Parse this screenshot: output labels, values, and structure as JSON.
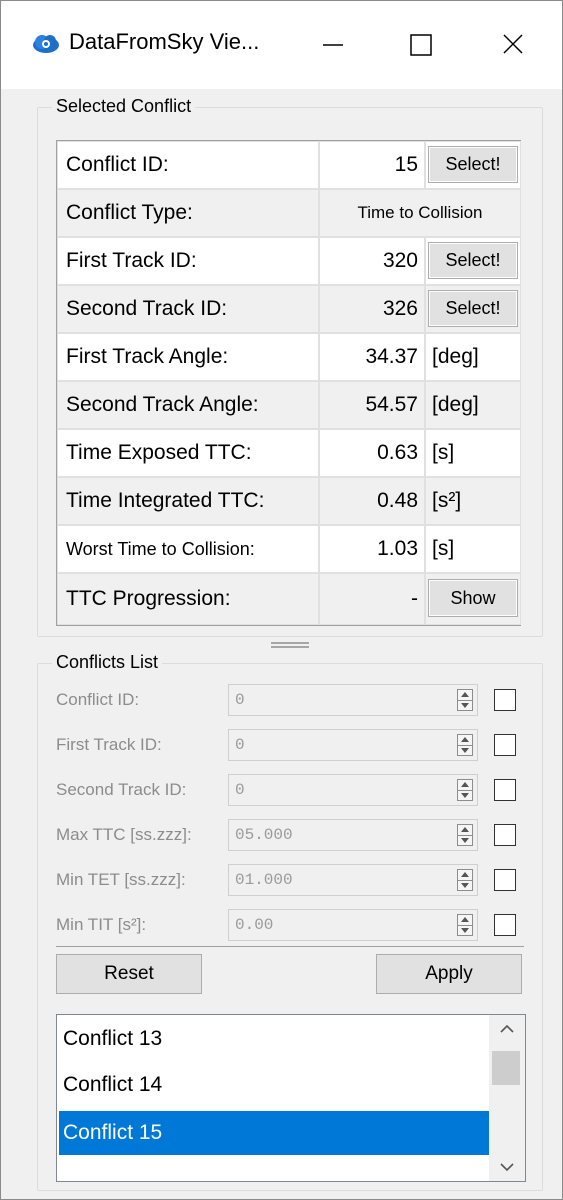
{
  "window": {
    "title": "DataFromSky Vie...",
    "icon": "cloud-icon",
    "controls": [
      "minimize-icon",
      "maximize-icon",
      "close-icon"
    ],
    "accent_color": "#0078d7"
  },
  "selected_conflict": {
    "group_title": "Selected Conflict",
    "conflict_id": {
      "label": "Conflict ID:",
      "value": "15",
      "button": "Select!"
    },
    "conflict_type": {
      "label": "Conflict Type:",
      "value": "Time to Collision"
    },
    "first_track_id": {
      "label": "First Track ID:",
      "value": "320",
      "button": "Select!"
    },
    "second_track_id": {
      "label": "Second Track ID:",
      "value": "326",
      "button": "Select!"
    },
    "first_track_angle": {
      "label": "First Track Angle:",
      "value": "34.37",
      "unit": "[deg]"
    },
    "second_track_angle": {
      "label": "Second Track Angle:",
      "value": "54.57",
      "unit": "[deg]"
    },
    "time_exposed_ttc": {
      "label": "Time Exposed TTC:",
      "value": "0.63",
      "unit": "[s]"
    },
    "time_integrated_ttc": {
      "label": "Time Integrated TTC:",
      "value": "0.48",
      "unit": "[s²]"
    },
    "worst_ttc": {
      "label": "Worst Time to Collision:",
      "value": "1.03",
      "unit": "[s]"
    },
    "ttc_progression": {
      "label": "TTC Progression:",
      "value": "-",
      "button": "Show"
    }
  },
  "conflicts_list": {
    "group_title": "Conflicts List",
    "filters": [
      {
        "label": "Conflict ID:",
        "value": "0",
        "checked": false
      },
      {
        "label": "First Track ID:",
        "value": "0",
        "checked": false
      },
      {
        "label": "Second Track ID:",
        "value": "0",
        "checked": false
      },
      {
        "label": "Max TTC [ss.zzz]:",
        "value": "05.000",
        "checked": false
      },
      {
        "label": "Min TET [ss.zzz]:",
        "value": "01.000",
        "checked": false
      },
      {
        "label": "Min TIT [s²]:",
        "value": "0.00",
        "checked": false
      }
    ],
    "reset_label": "Reset",
    "apply_label": "Apply",
    "items": [
      "Conflict 13",
      "Conflict 14",
      "Conflict 15"
    ],
    "selected_item": "Conflict 15"
  }
}
